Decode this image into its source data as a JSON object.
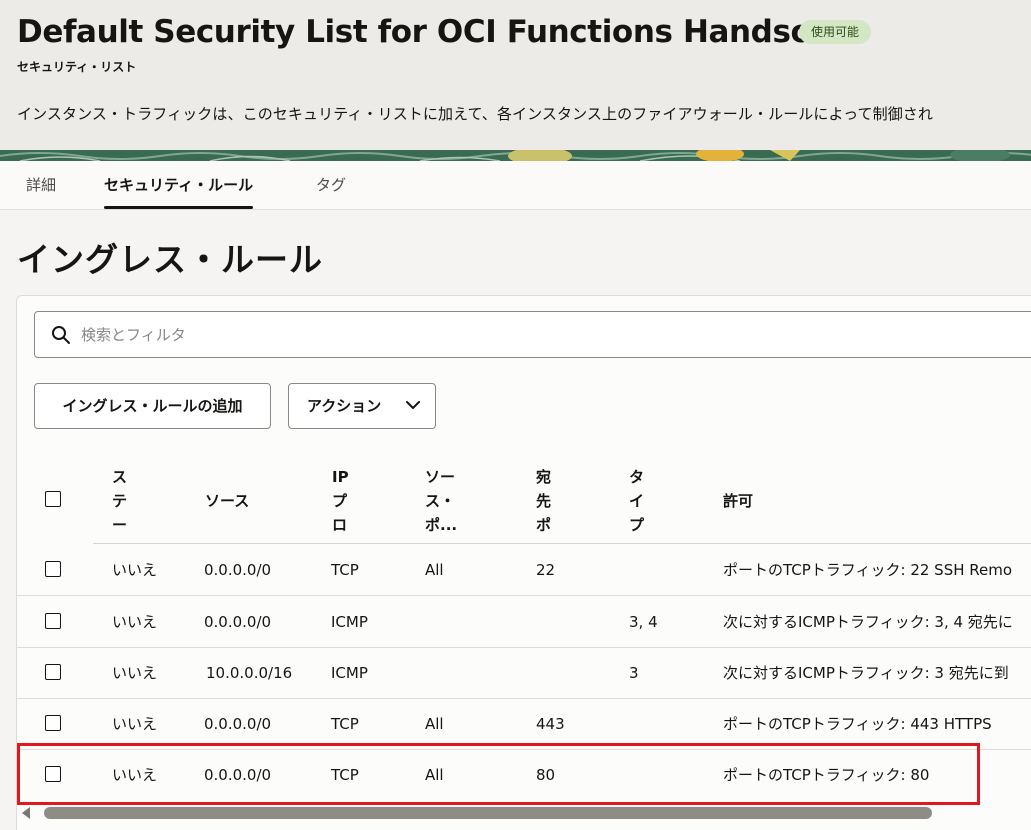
{
  "header": {
    "title": "Default Security List for OCI Functions Handson",
    "status_badge": "使用可能",
    "subtitle": "セキュリティ・リスト",
    "description": "インスタンス・トラフィックは、このセキュリティ・リストに加えて、各インスタンス上のファイアウォール・ルールによって制御され"
  },
  "tabs": [
    {
      "label": "詳細",
      "active": false
    },
    {
      "label": "セキュリティ・ルール",
      "active": true
    },
    {
      "label": "タグ",
      "active": false
    }
  ],
  "section": {
    "title": "イングレス・ルール"
  },
  "search": {
    "placeholder": "検索とフィルタ",
    "value": ""
  },
  "toolbar": {
    "add_label": "イングレス・ルールの追加",
    "actions_label": "アクション"
  },
  "table": {
    "columns": {
      "stateless": [
        "ス",
        "テ",
        "ー"
      ],
      "source": "ソース",
      "ip_protocol": [
        "IP",
        "プ",
        "ロ"
      ],
      "source_port": [
        "ソー",
        "ス・",
        "ポ..."
      ],
      "dest_port": [
        "宛",
        "先",
        "ポ"
      ],
      "type": [
        "タ",
        "イ",
        "プ"
      ],
      "allows": "許可"
    },
    "rows": [
      {
        "stateless": "いいえ",
        "source": "0.0.0.0/0",
        "protocol": "TCP",
        "source_port": "All",
        "dest_port": "22",
        "type": "",
        "allows": "ポートのTCPトラフィック: 22 SSH Remo"
      },
      {
        "stateless": "いいえ",
        "source": "0.0.0.0/0",
        "protocol": "ICMP",
        "source_port": "",
        "dest_port": "",
        "type": "3, 4",
        "allows": "次に対するICMPトラフィック: 3, 4 宛先に"
      },
      {
        "stateless": "いいえ",
        "source": "10.0.0.0/16",
        "protocol": "ICMP",
        "source_port": "",
        "dest_port": "",
        "type": "3",
        "allows": "次に対するICMPトラフィック: 3 宛先に到"
      },
      {
        "stateless": "いいえ",
        "source": "0.0.0.0/0",
        "protocol": "TCP",
        "source_port": "All",
        "dest_port": "443",
        "type": "",
        "allows": "ポートのTCPトラフィック: 443 HTTPS"
      },
      {
        "stateless": "いいえ",
        "source": "0.0.0.0/0",
        "protocol": "TCP",
        "source_port": "All",
        "dest_port": "80",
        "type": "",
        "allows": "ポートのTCPトラフィック: 80"
      }
    ]
  },
  "colors": {
    "highlight": "#e4161f",
    "badge_bg": "#d3e7c4",
    "header_bg": "#edebe8"
  }
}
